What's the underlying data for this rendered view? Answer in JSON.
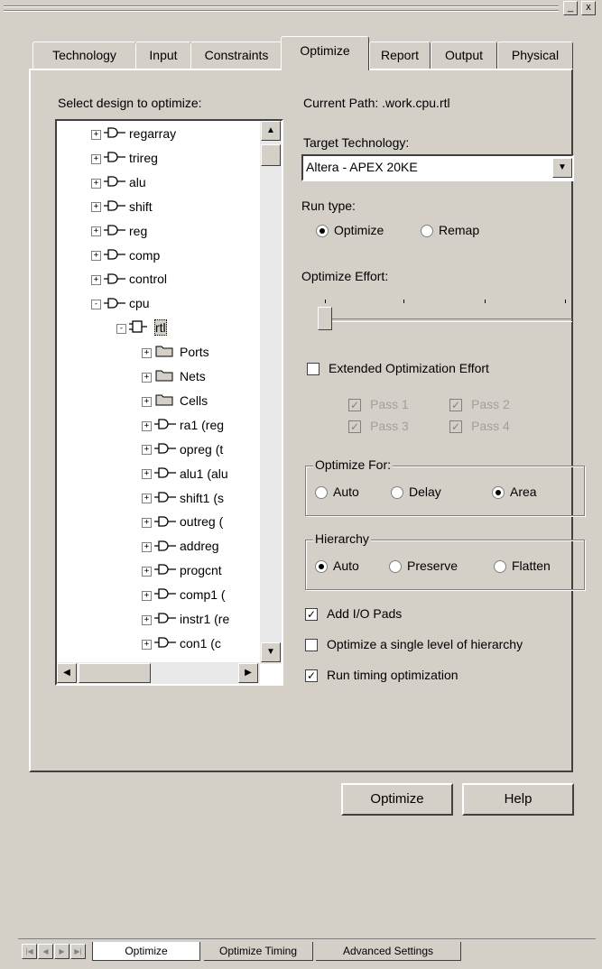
{
  "window": {
    "minimize_glyph": "_",
    "close_glyph": "x"
  },
  "tabs": [
    {
      "label": "Technology"
    },
    {
      "label": "Input"
    },
    {
      "label": "Constraints"
    },
    {
      "label": "Optimize"
    },
    {
      "label": "Report"
    },
    {
      "label": "Output"
    },
    {
      "label": "Physical"
    }
  ],
  "active_tab": "Optimize",
  "tree": {
    "label": "Select design to optimize:",
    "items": [
      {
        "text": "regarray",
        "expander": "+",
        "icon": "gate-icon"
      },
      {
        "text": "trireg",
        "expander": "+",
        "icon": "gate-icon"
      },
      {
        "text": "alu",
        "expander": "+",
        "icon": "gate-icon"
      },
      {
        "text": "shift",
        "expander": "+",
        "icon": "gate-icon"
      },
      {
        "text": "reg",
        "expander": "+",
        "icon": "gate-icon"
      },
      {
        "text": "comp",
        "expander": "+",
        "icon": "gate-icon"
      },
      {
        "text": "control",
        "expander": "+",
        "icon": "gate-icon"
      },
      {
        "text": "cpu",
        "expander": "-",
        "icon": "gate-icon"
      },
      {
        "text": "rtl",
        "expander": "-",
        "icon": "chip-icon"
      },
      {
        "text": "Ports",
        "expander": "+",
        "icon": "folder-icon"
      },
      {
        "text": "Nets",
        "expander": "+",
        "icon": "folder-icon"
      },
      {
        "text": "Cells",
        "expander": "+",
        "icon": "folder-icon"
      },
      {
        "text": "ra1 (reg",
        "expander": "+",
        "icon": "gate-icon"
      },
      {
        "text": "opreg (t",
        "expander": "+",
        "icon": "gate-icon"
      },
      {
        "text": "alu1 (alu",
        "expander": "+",
        "icon": "gate-icon"
      },
      {
        "text": "shift1 (s",
        "expander": "+",
        "icon": "gate-icon"
      },
      {
        "text": "outreg (",
        "expander": "+",
        "icon": "gate-icon"
      },
      {
        "text": "addreg",
        "expander": "+",
        "icon": "gate-icon"
      },
      {
        "text": "progcnt",
        "expander": "+",
        "icon": "gate-icon"
      },
      {
        "text": "comp1 (",
        "expander": "+",
        "icon": "gate-icon"
      },
      {
        "text": "instr1 (re",
        "expander": "+",
        "icon": "gate-icon"
      },
      {
        "text": "con1 (c",
        "expander": "+",
        "icon": "gate-icon"
      }
    ]
  },
  "current_path": "Current Path: .work.cpu.rtl",
  "target_technology": {
    "label": "Target Technology:",
    "value": "Altera - APEX 20KE"
  },
  "run_type": {
    "label": "Run type:",
    "options": [
      "Optimize",
      "Remap"
    ],
    "selected": "Optimize"
  },
  "optimize_effort": {
    "label": "Optimize Effort:",
    "value": 0,
    "ticks": 4
  },
  "extended_effort": {
    "label": "Extended Optimization Effort",
    "checked": false,
    "passes": [
      "Pass 1",
      "Pass 2",
      "Pass 3",
      "Pass 4"
    ]
  },
  "optimize_for": {
    "label": "Optimize For:",
    "options": [
      "Auto",
      "Delay",
      "Area"
    ],
    "selected": "Area"
  },
  "hierarchy": {
    "label": "Hierarchy",
    "options": [
      "Auto",
      "Preserve",
      "Flatten"
    ],
    "selected": "Auto"
  },
  "options": [
    {
      "label": "Add I/O Pads",
      "checked": true
    },
    {
      "label": "Optimize a single level of hierarchy",
      "checked": false
    },
    {
      "label": "Run timing optimization",
      "checked": true
    }
  ],
  "buttons": {
    "optimize": "Optimize",
    "help": "Help"
  },
  "bottom_tabs": [
    {
      "label": "Optimize"
    },
    {
      "label": "Optimize Timing"
    },
    {
      "label": "Advanced Settings"
    }
  ]
}
